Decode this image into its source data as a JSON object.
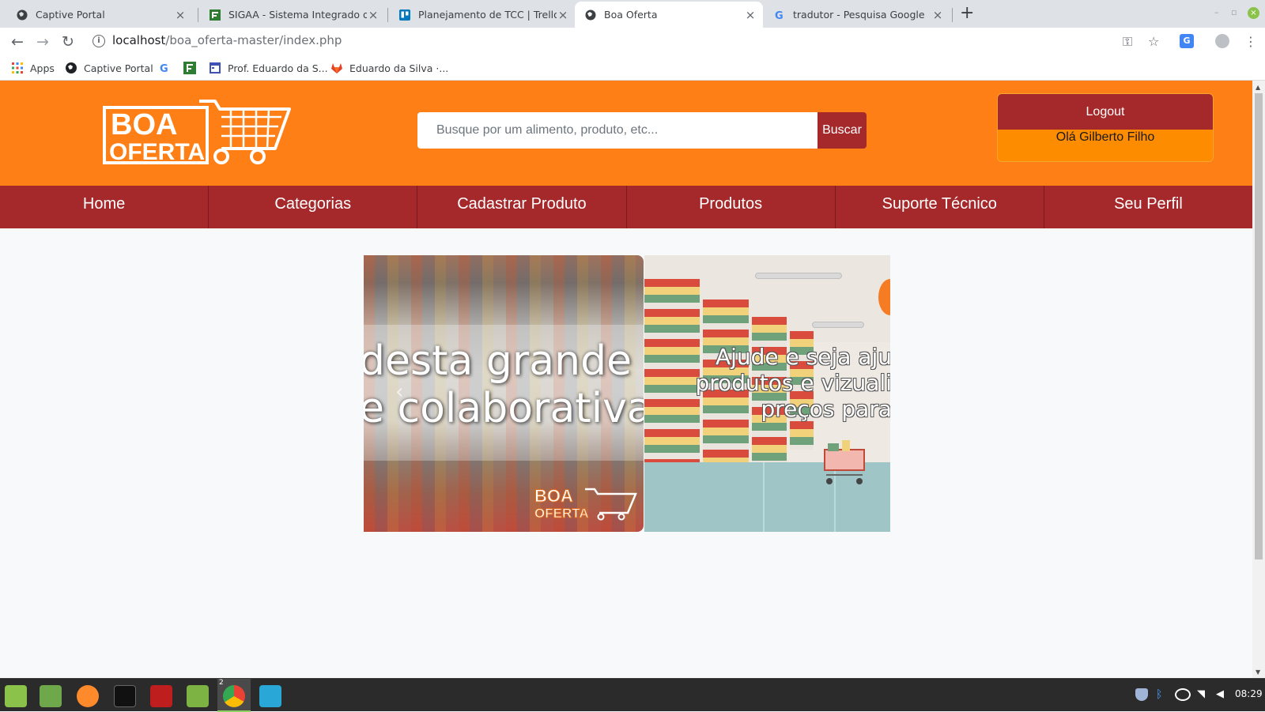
{
  "browser": {
    "tabs": [
      {
        "title": "Captive Portal",
        "favicon": "globe-icon"
      },
      {
        "title": "SIGAA - Sistema Integrado de G",
        "favicon": "sigaa-icon"
      },
      {
        "title": "Planejamento de TCC | Trello",
        "favicon": "trello-icon"
      },
      {
        "title": "Boa Oferta",
        "favicon": "globe-icon",
        "active": true
      },
      {
        "title": "tradutor - Pesquisa Google",
        "favicon": "google-icon"
      }
    ],
    "url_host": "localhost",
    "url_path": "/boa_oferta-master/index.php",
    "bookmarks": [
      {
        "label": "Apps",
        "icon": "apps-grid-icon"
      },
      {
        "label": "Captive Portal",
        "icon": "globe-icon"
      },
      {
        "label": "",
        "icon": "google-icon"
      },
      {
        "label": "",
        "icon": "sigaa-icon"
      },
      {
        "label": "Prof. Eduardo da S...",
        "icon": "calendar-icon"
      },
      {
        "label": "Eduardo da Silva ·...",
        "icon": "gitlab-icon"
      }
    ]
  },
  "site": {
    "logo_line1": "BOA",
    "logo_line2": "OFERTA",
    "search_placeholder": "Busque por um alimento, produto, etc...",
    "search_button": "Buscar",
    "logout": "Logout",
    "greeting": "Olá Gilberto Filho",
    "colors": {
      "header": "#fe7f15",
      "nav": "#a5282b",
      "accent": "#a5282b"
    },
    "nav": [
      "Home",
      "Categorias",
      "Cadastrar Produto",
      "Produtos",
      "Suporte Técnico",
      "Seu Perfil"
    ]
  },
  "carousel": {
    "slide1_line1": "desta grande",
    "slide1_line2": "e colaborativa",
    "slide2_line1": "Ajude e seja aju",
    "slide2_line2": "produtos e vizuali",
    "slide2_line3": "preços para"
  },
  "taskbar": {
    "clock": "08:29",
    "chrome_badge": "2"
  }
}
